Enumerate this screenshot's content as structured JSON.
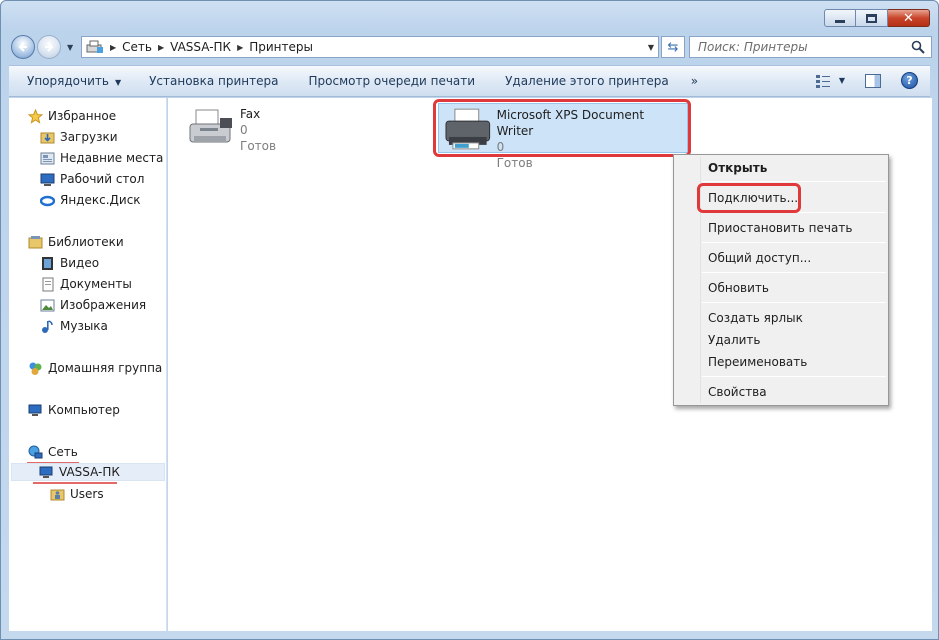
{
  "window": {
    "caption_buttons": {
      "minimize": "",
      "maximize": "",
      "close": "✕"
    }
  },
  "address_bar": {
    "breadcrumbs": [
      "Сеть",
      "VASSA-ПК",
      "Принтеры"
    ]
  },
  "search": {
    "placeholder": "Поиск: Принтеры"
  },
  "command_bar": {
    "organize": "Упорядочить",
    "add_printer": "Установка принтера",
    "view_queue": "Просмотр очереди печати",
    "delete_printer": "Удаление этого принтера",
    "more": "»"
  },
  "nav": {
    "favorites": "Избранное",
    "downloads": "Загрузки",
    "recent_places": "Недавние места",
    "desktop": "Рабочий стол",
    "yandex_disk": "Яндекс.Диск",
    "libraries": "Библиотеки",
    "video": "Видео",
    "documents": "Документы",
    "pictures": "Изображения",
    "music": "Музыка",
    "homegroup": "Домашняя группа",
    "computer": "Компьютер",
    "network": "Сеть",
    "vassa_pc": "VASSA-ПК",
    "users": "Users"
  },
  "printers": [
    {
      "name": "Fax",
      "jobs": "0",
      "status": "Готов"
    },
    {
      "name": "Microsoft XPS Document Writer",
      "jobs": "0",
      "status": "Готов"
    }
  ],
  "context_menu": {
    "open": "Открыть",
    "connect": "Подключить...",
    "pause": "Приостановить печать",
    "sharing": "Общий доступ...",
    "refresh": "Обновить",
    "create_shortcut": "Создать ярлык",
    "delete": "Удалить",
    "rename": "Переименовать",
    "properties": "Свойства"
  },
  "colors": {
    "accent_highlight": "#e0393b",
    "selection": "#cde3f7"
  }
}
